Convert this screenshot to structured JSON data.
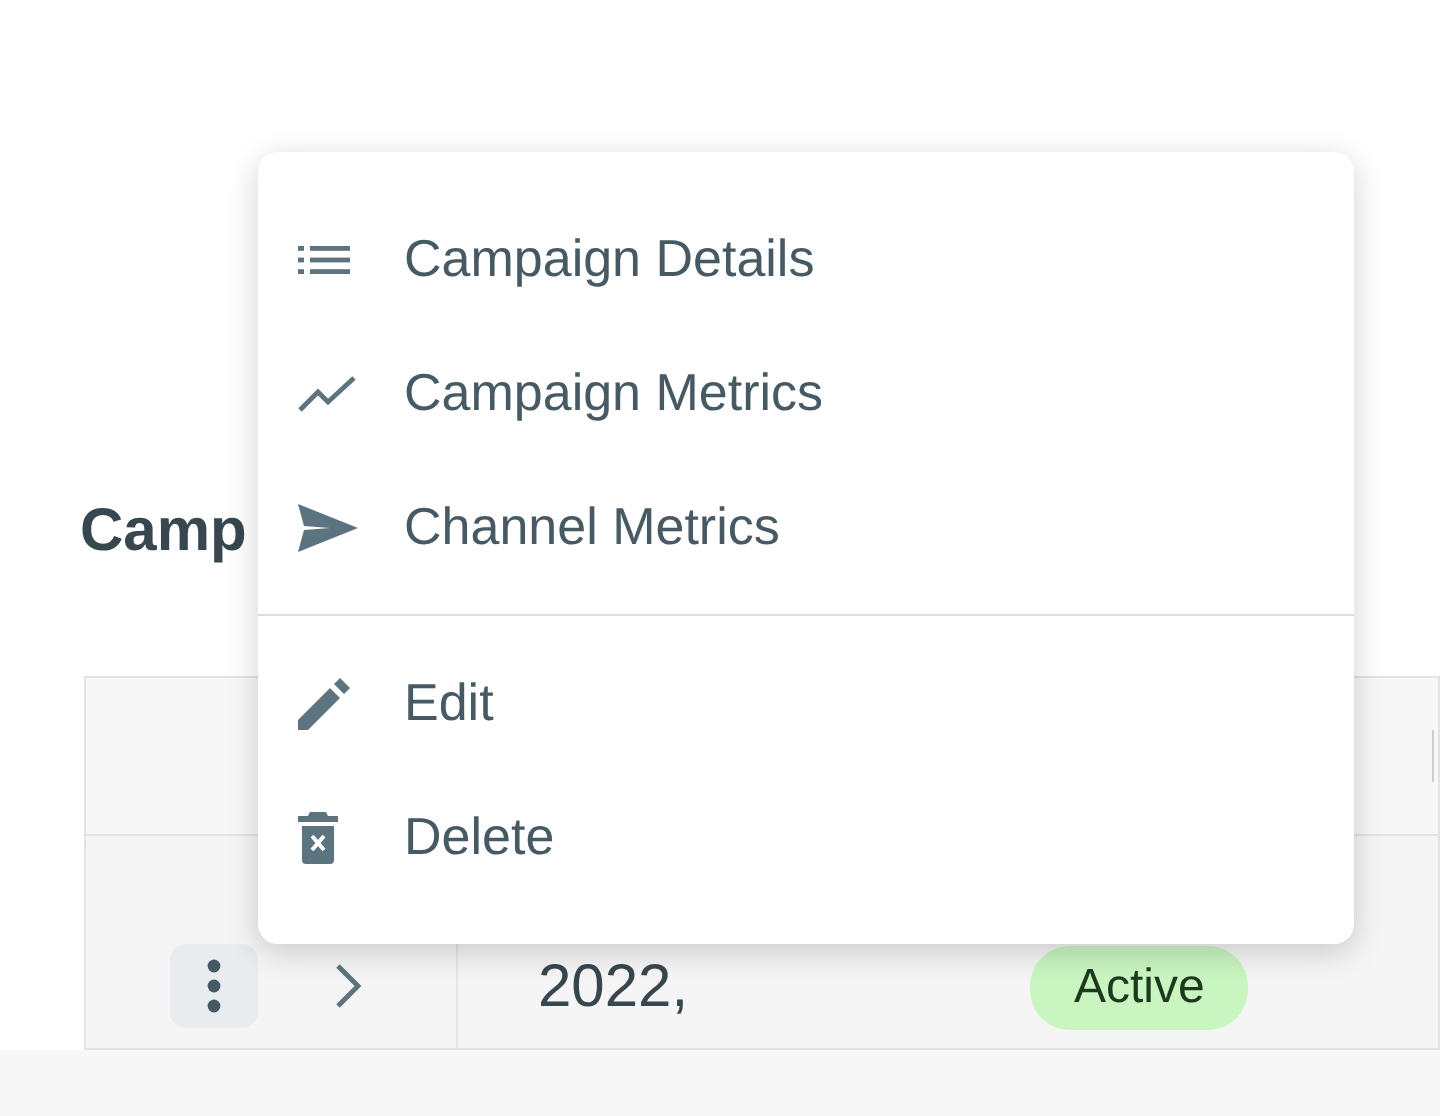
{
  "heading": "Camp",
  "table": {
    "rows": [
      {
        "date": "2022,",
        "status": "Active"
      }
    ]
  },
  "menu": {
    "sections": [
      [
        {
          "kind": "list",
          "label": "Campaign Details"
        },
        {
          "kind": "trend",
          "label": "Campaign Metrics"
        },
        {
          "kind": "send",
          "label": "Channel Metrics"
        }
      ],
      [
        {
          "kind": "edit",
          "label": "Edit"
        },
        {
          "kind": "delete",
          "label": "Delete"
        }
      ]
    ]
  }
}
